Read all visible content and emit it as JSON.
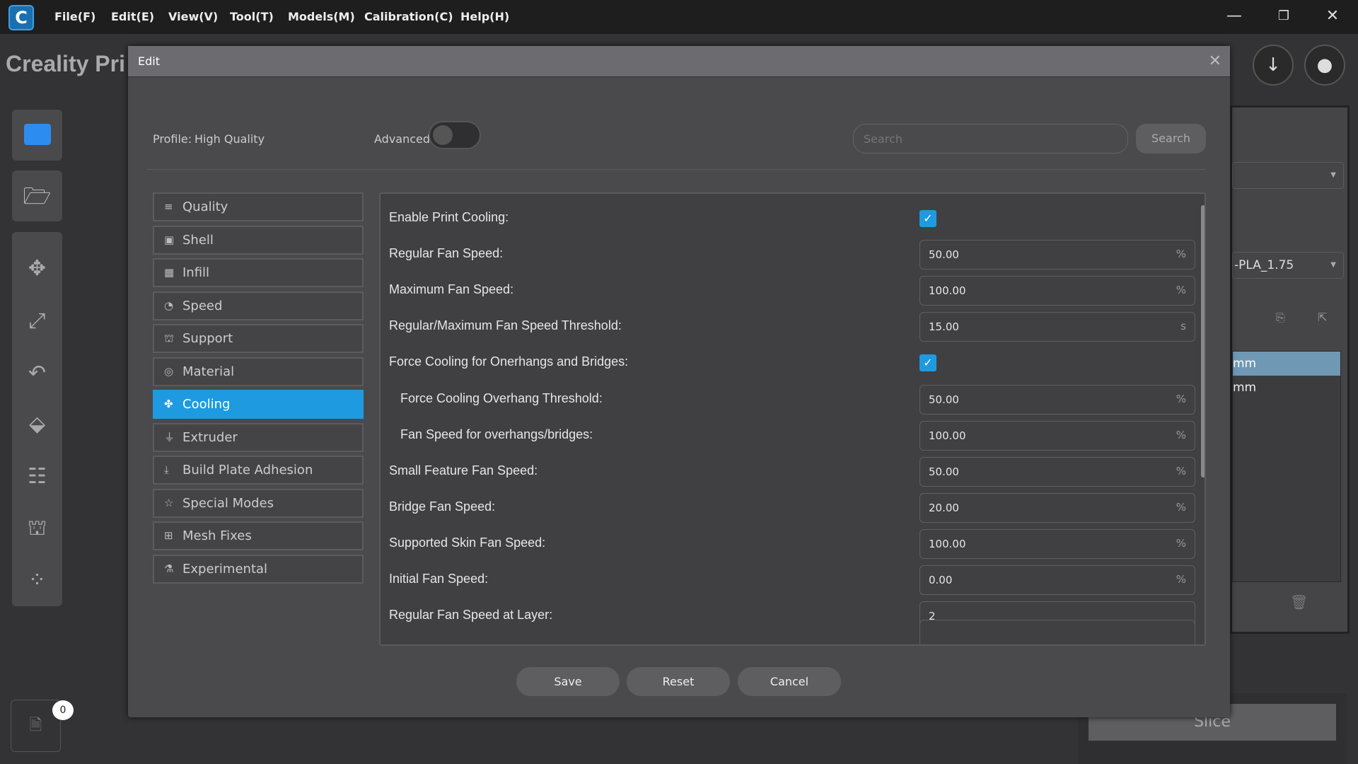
{
  "menubar": {
    "items": [
      "File(F)",
      "Edit(E)",
      "View(V)",
      "Tool(T)",
      "Models(M)",
      "Calibration(C)",
      "Help(H)"
    ]
  },
  "app": {
    "title": "Creality Pri"
  },
  "right_panel": {
    "material": "-PLA_1.75",
    "list": [
      "mm",
      "mm"
    ],
    "slice": "Slice"
  },
  "job_badge": "0",
  "dialog": {
    "title": "Edit",
    "profile_label": "Profile:",
    "profile_value": "High Quality",
    "advanced_label": "Advanced",
    "advanced_on": false,
    "search_placeholder": "Search",
    "search_button": "Search",
    "categories": [
      {
        "label": "Quality",
        "icon": "≡"
      },
      {
        "label": "Shell",
        "icon": "▣"
      },
      {
        "label": "Infill",
        "icon": "▦"
      },
      {
        "label": "Speed",
        "icon": "◔"
      },
      {
        "label": "Support",
        "icon": "⛫"
      },
      {
        "label": "Material",
        "icon": "◎"
      },
      {
        "label": "Cooling",
        "icon": "✤",
        "active": true
      },
      {
        "label": "Extruder",
        "icon": "⏚"
      },
      {
        "label": "Build Plate Adhesion",
        "icon": "⤓"
      },
      {
        "label": "Special Modes",
        "icon": "☆"
      },
      {
        "label": "Mesh Fixes",
        "icon": "⊞"
      },
      {
        "label": "Experimental",
        "icon": "⚗"
      }
    ],
    "settings": [
      {
        "label": "Enable Print Cooling:",
        "type": "checkbox",
        "checked": true
      },
      {
        "label": "Regular Fan Speed:",
        "value": "50.00",
        "unit": "%"
      },
      {
        "label": "Maximum Fan Speed:",
        "value": "100.00",
        "unit": "%"
      },
      {
        "label": "Regular/Maximum Fan Speed Threshold:",
        "value": "15.00",
        "unit": "s"
      },
      {
        "label": "Force Cooling for Onerhangs and Bridges:",
        "type": "checkbox",
        "checked": true
      },
      {
        "label": "Force Cooling Overhang Threshold:",
        "value": "50.00",
        "unit": "%",
        "indent": true
      },
      {
        "label": "Fan Speed for overhangs/bridges:",
        "value": "100.00",
        "unit": "%",
        "indent": true
      },
      {
        "label": "Small Feature Fan Speed:",
        "value": "50.00",
        "unit": "%"
      },
      {
        "label": "Bridge Fan Speed:",
        "value": "20.00",
        "unit": "%"
      },
      {
        "label": "Supported Skin Fan Speed:",
        "value": "100.00",
        "unit": "%"
      },
      {
        "label": "Initial Fan Speed:",
        "value": "0.00",
        "unit": "%"
      },
      {
        "label": "Regular Fan Speed at Layer:",
        "value": "2",
        "unit": ""
      }
    ],
    "buttons": {
      "save": "Save",
      "reset": "Reset",
      "cancel": "Cancel"
    }
  },
  "colors": {
    "accent": "#1e9be0",
    "menubar": "#1e1e1e",
    "dialog": "#4a4a4c"
  }
}
